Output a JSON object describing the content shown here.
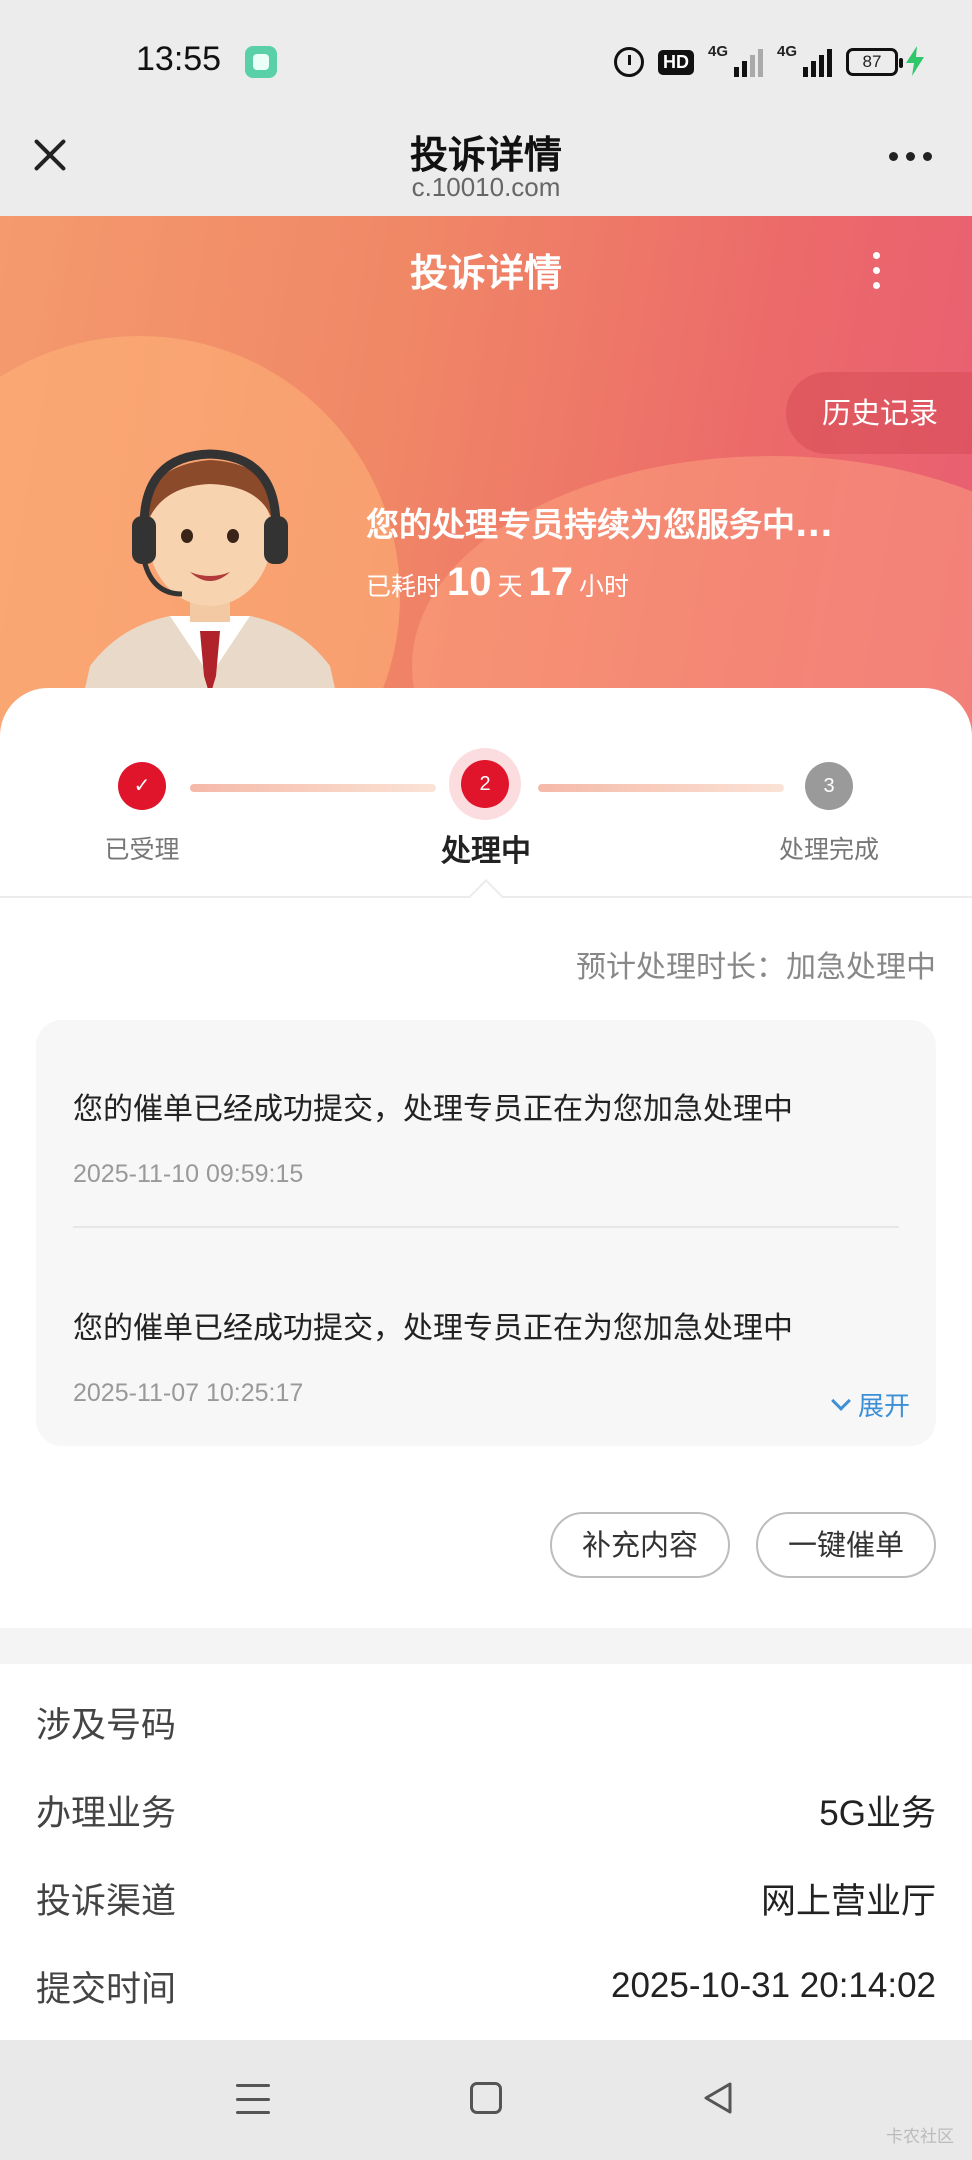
{
  "status_bar": {
    "time": "13:55",
    "hd_label": "HD",
    "signal1_label": "4G",
    "signal2_label": "4G",
    "battery": "87"
  },
  "browser": {
    "title": "投诉详情",
    "url": "c.10010.com"
  },
  "hero": {
    "title": "投诉详情",
    "history_button": "历史记录",
    "status_text": "您的处理专员持续为您服务中...",
    "elapsed_prefix": "已耗时",
    "days": "10",
    "days_unit": "天",
    "hours": "17",
    "hours_unit": "小时"
  },
  "progress": {
    "current_step": 2,
    "steps": [
      {
        "number": "✓",
        "label": "已受理"
      },
      {
        "number": "2",
        "label": "处理中"
      },
      {
        "number": "3",
        "label": "处理完成"
      }
    ]
  },
  "eta": "预计处理时长：加急处理中",
  "records": [
    {
      "text": "您的催单已经成功提交，处理专员正在为您加急处理中",
      "time": "2025-11-10 09:59:15"
    },
    {
      "text": "您的催单已经成功提交，处理专员正在为您加急处理中",
      "time": "2025-11-07 10:25:17"
    }
  ],
  "expand_label": "展开",
  "actions": {
    "supplement": "补充内容",
    "urge": "一键催单"
  },
  "details": [
    {
      "key": "涉及号码",
      "value": ""
    },
    {
      "key": "办理业务",
      "value": "5G业务"
    },
    {
      "key": "投诉渠道",
      "value": "网上营业厅"
    },
    {
      "key": "提交时间",
      "value": "2025-10-31 20:14:02"
    }
  ],
  "watermark": "卡农社区",
  "colors": {
    "accent": "#e0142a",
    "link": "#3d8fd6",
    "hero_start": "#f49a6e",
    "hero_end": "#e85e72"
  }
}
